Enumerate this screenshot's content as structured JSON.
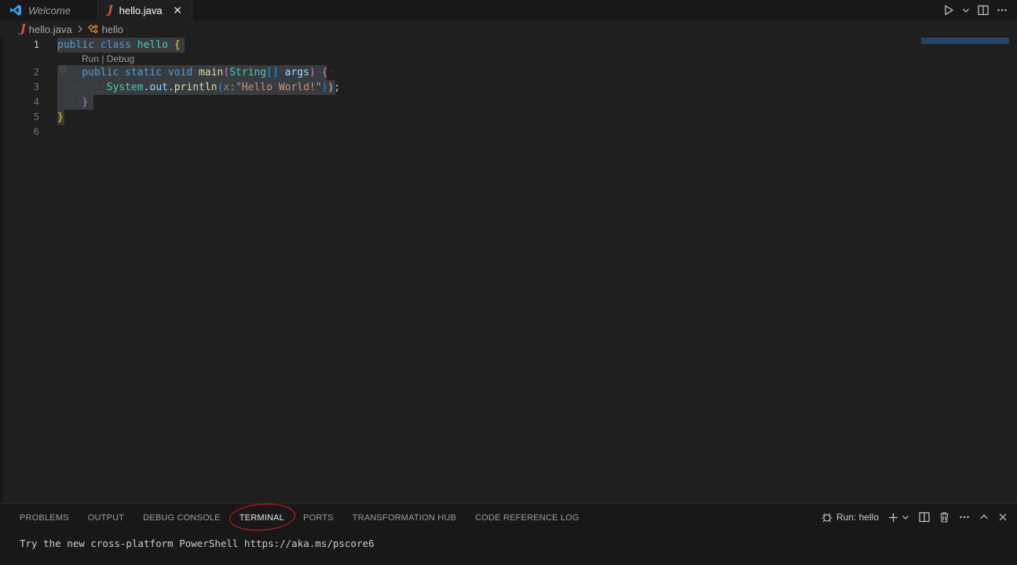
{
  "tabs": [
    {
      "label": "Welcome",
      "active": false
    },
    {
      "label": "hello.java",
      "active": true
    }
  ],
  "tab_close_glyph": "✕",
  "breadcrumb": {
    "file": "hello.java",
    "symbol": "hello"
  },
  "editor": {
    "line_numbers": [
      "1",
      "2",
      "3",
      "4",
      "5",
      "6"
    ],
    "codelens": "Run | Debug",
    "code": {
      "l1_kw1": "public",
      "l1_kw2": "class",
      "l1_name": "hello",
      "l1_brace": "{",
      "l2_kw1": "public",
      "l2_kw2": "static",
      "l2_kw3": "void",
      "l2_fn": "main",
      "l2_paren_open": "(",
      "l2_type": "String",
      "l2_arr": "[]",
      "l2_arg": "args",
      "l2_paren_close": ")",
      "l2_brace": "{",
      "l3_obj": "System",
      "l3_field": "out",
      "l3_fn": "println",
      "l3_hint": "x:",
      "l3_str": "\"Hello World!\"",
      "l3_end": ");",
      "l4_brace": "}",
      "l5_brace": "}"
    }
  },
  "panel": {
    "tabs": [
      "PROBLEMS",
      "OUTPUT",
      "DEBUG CONSOLE",
      "TERMINAL",
      "PORTS",
      "TRANSFORMATION HUB",
      "CODE REFERENCE LOG"
    ],
    "active_tab": "TERMINAL",
    "run_label": "Run: hello",
    "terminal_line": "Try the new cross-platform PowerShell https://aka.ms/pscore6"
  },
  "colors": {
    "accent_red": "#e02020",
    "editor_bg": "#1f1f1f",
    "panel_bg": "#181818"
  }
}
